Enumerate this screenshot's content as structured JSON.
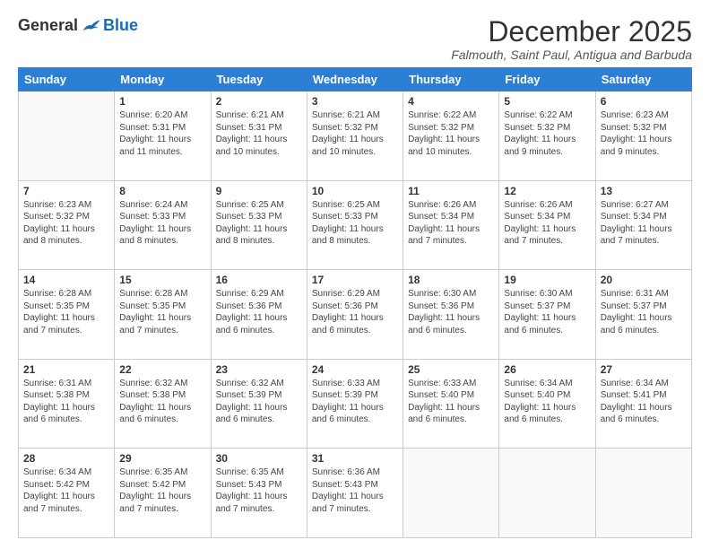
{
  "logo": {
    "general": "General",
    "blue": "Blue"
  },
  "title": "December 2025",
  "location": "Falmouth, Saint Paul, Antigua and Barbuda",
  "weekdays": [
    "Sunday",
    "Monday",
    "Tuesday",
    "Wednesday",
    "Thursday",
    "Friday",
    "Saturday"
  ],
  "weeks": [
    [
      {
        "day": "",
        "sunrise": "",
        "sunset": "",
        "daylight": ""
      },
      {
        "day": "1",
        "sunrise": "Sunrise: 6:20 AM",
        "sunset": "Sunset: 5:31 PM",
        "daylight": "Daylight: 11 hours and 11 minutes."
      },
      {
        "day": "2",
        "sunrise": "Sunrise: 6:21 AM",
        "sunset": "Sunset: 5:31 PM",
        "daylight": "Daylight: 11 hours and 10 minutes."
      },
      {
        "day": "3",
        "sunrise": "Sunrise: 6:21 AM",
        "sunset": "Sunset: 5:32 PM",
        "daylight": "Daylight: 11 hours and 10 minutes."
      },
      {
        "day": "4",
        "sunrise": "Sunrise: 6:22 AM",
        "sunset": "Sunset: 5:32 PM",
        "daylight": "Daylight: 11 hours and 10 minutes."
      },
      {
        "day": "5",
        "sunrise": "Sunrise: 6:22 AM",
        "sunset": "Sunset: 5:32 PM",
        "daylight": "Daylight: 11 hours and 9 minutes."
      },
      {
        "day": "6",
        "sunrise": "Sunrise: 6:23 AM",
        "sunset": "Sunset: 5:32 PM",
        "daylight": "Daylight: 11 hours and 9 minutes."
      }
    ],
    [
      {
        "day": "7",
        "sunrise": "Sunrise: 6:23 AM",
        "sunset": "Sunset: 5:32 PM",
        "daylight": "Daylight: 11 hours and 8 minutes."
      },
      {
        "day": "8",
        "sunrise": "Sunrise: 6:24 AM",
        "sunset": "Sunset: 5:33 PM",
        "daylight": "Daylight: 11 hours and 8 minutes."
      },
      {
        "day": "9",
        "sunrise": "Sunrise: 6:25 AM",
        "sunset": "Sunset: 5:33 PM",
        "daylight": "Daylight: 11 hours and 8 minutes."
      },
      {
        "day": "10",
        "sunrise": "Sunrise: 6:25 AM",
        "sunset": "Sunset: 5:33 PM",
        "daylight": "Daylight: 11 hours and 8 minutes."
      },
      {
        "day": "11",
        "sunrise": "Sunrise: 6:26 AM",
        "sunset": "Sunset: 5:34 PM",
        "daylight": "Daylight: 11 hours and 7 minutes."
      },
      {
        "day": "12",
        "sunrise": "Sunrise: 6:26 AM",
        "sunset": "Sunset: 5:34 PM",
        "daylight": "Daylight: 11 hours and 7 minutes."
      },
      {
        "day": "13",
        "sunrise": "Sunrise: 6:27 AM",
        "sunset": "Sunset: 5:34 PM",
        "daylight": "Daylight: 11 hours and 7 minutes."
      }
    ],
    [
      {
        "day": "14",
        "sunrise": "Sunrise: 6:28 AM",
        "sunset": "Sunset: 5:35 PM",
        "daylight": "Daylight: 11 hours and 7 minutes."
      },
      {
        "day": "15",
        "sunrise": "Sunrise: 6:28 AM",
        "sunset": "Sunset: 5:35 PM",
        "daylight": "Daylight: 11 hours and 7 minutes."
      },
      {
        "day": "16",
        "sunrise": "Sunrise: 6:29 AM",
        "sunset": "Sunset: 5:36 PM",
        "daylight": "Daylight: 11 hours and 6 minutes."
      },
      {
        "day": "17",
        "sunrise": "Sunrise: 6:29 AM",
        "sunset": "Sunset: 5:36 PM",
        "daylight": "Daylight: 11 hours and 6 minutes."
      },
      {
        "day": "18",
        "sunrise": "Sunrise: 6:30 AM",
        "sunset": "Sunset: 5:36 PM",
        "daylight": "Daylight: 11 hours and 6 minutes."
      },
      {
        "day": "19",
        "sunrise": "Sunrise: 6:30 AM",
        "sunset": "Sunset: 5:37 PM",
        "daylight": "Daylight: 11 hours and 6 minutes."
      },
      {
        "day": "20",
        "sunrise": "Sunrise: 6:31 AM",
        "sunset": "Sunset: 5:37 PM",
        "daylight": "Daylight: 11 hours and 6 minutes."
      }
    ],
    [
      {
        "day": "21",
        "sunrise": "Sunrise: 6:31 AM",
        "sunset": "Sunset: 5:38 PM",
        "daylight": "Daylight: 11 hours and 6 minutes."
      },
      {
        "day": "22",
        "sunrise": "Sunrise: 6:32 AM",
        "sunset": "Sunset: 5:38 PM",
        "daylight": "Daylight: 11 hours and 6 minutes."
      },
      {
        "day": "23",
        "sunrise": "Sunrise: 6:32 AM",
        "sunset": "Sunset: 5:39 PM",
        "daylight": "Daylight: 11 hours and 6 minutes."
      },
      {
        "day": "24",
        "sunrise": "Sunrise: 6:33 AM",
        "sunset": "Sunset: 5:39 PM",
        "daylight": "Daylight: 11 hours and 6 minutes."
      },
      {
        "day": "25",
        "sunrise": "Sunrise: 6:33 AM",
        "sunset": "Sunset: 5:40 PM",
        "daylight": "Daylight: 11 hours and 6 minutes."
      },
      {
        "day": "26",
        "sunrise": "Sunrise: 6:34 AM",
        "sunset": "Sunset: 5:40 PM",
        "daylight": "Daylight: 11 hours and 6 minutes."
      },
      {
        "day": "27",
        "sunrise": "Sunrise: 6:34 AM",
        "sunset": "Sunset: 5:41 PM",
        "daylight": "Daylight: 11 hours and 6 minutes."
      }
    ],
    [
      {
        "day": "28",
        "sunrise": "Sunrise: 6:34 AM",
        "sunset": "Sunset: 5:42 PM",
        "daylight": "Daylight: 11 hours and 7 minutes."
      },
      {
        "day": "29",
        "sunrise": "Sunrise: 6:35 AM",
        "sunset": "Sunset: 5:42 PM",
        "daylight": "Daylight: 11 hours and 7 minutes."
      },
      {
        "day": "30",
        "sunrise": "Sunrise: 6:35 AM",
        "sunset": "Sunset: 5:43 PM",
        "daylight": "Daylight: 11 hours and 7 minutes."
      },
      {
        "day": "31",
        "sunrise": "Sunrise: 6:36 AM",
        "sunset": "Sunset: 5:43 PM",
        "daylight": "Daylight: 11 hours and 7 minutes."
      },
      {
        "day": "",
        "sunrise": "",
        "sunset": "",
        "daylight": ""
      },
      {
        "day": "",
        "sunrise": "",
        "sunset": "",
        "daylight": ""
      },
      {
        "day": "",
        "sunrise": "",
        "sunset": "",
        "daylight": ""
      }
    ]
  ]
}
